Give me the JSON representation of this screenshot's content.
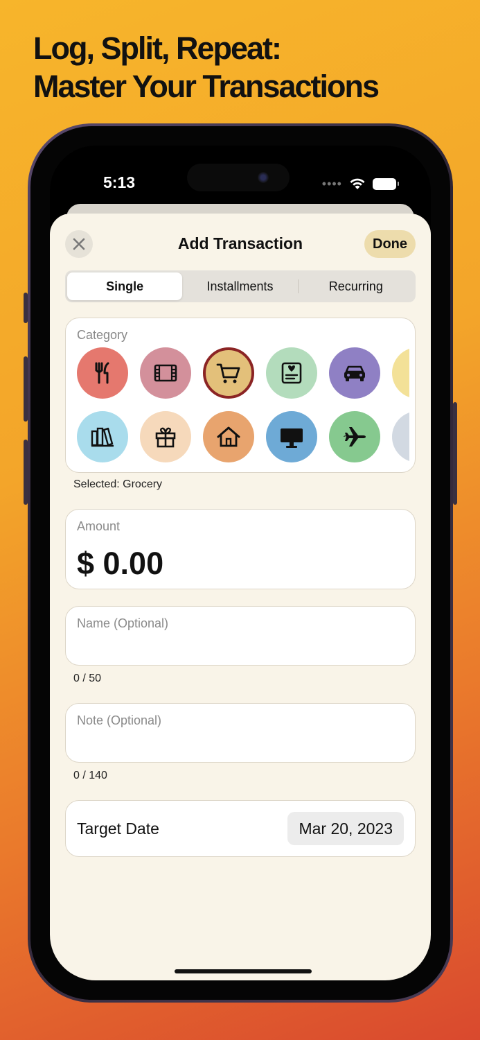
{
  "headline": {
    "line1": "Log, Split, Repeat:",
    "line2": "Master Your Transactions"
  },
  "status_bar": {
    "time": "5:13",
    "signal_dots": "••••"
  },
  "sheet": {
    "title": "Add Transaction",
    "close_icon": "x-mark-icon",
    "done_label": "Done"
  },
  "segments": [
    {
      "label": "Single",
      "selected": true
    },
    {
      "label": "Installments",
      "selected": false
    },
    {
      "label": "Recurring",
      "selected": false
    }
  ],
  "category": {
    "label": "Category",
    "selected_text": "Selected: Grocery",
    "icons": [
      {
        "name": "restaurant-icon",
        "color": "#e5786e"
      },
      {
        "name": "movie-film-icon",
        "color": "#d3909b"
      },
      {
        "name": "shopping-cart-icon",
        "color": "#e3c07a",
        "selected": true
      },
      {
        "name": "health-card-icon",
        "color": "#b3dcbc"
      },
      {
        "name": "car-icon",
        "color": "#8f80c4"
      },
      {
        "name": "partial-icon",
        "color": "#f3e198"
      },
      {
        "name": "books-icon",
        "color": "#a9dcec"
      },
      {
        "name": "gift-icon",
        "color": "#f6d9bb"
      },
      {
        "name": "home-icon",
        "color": "#e8a46e"
      },
      {
        "name": "computer-monitor-icon",
        "color": "#6eaad6"
      },
      {
        "name": "airplane-icon",
        "color": "#86c98f"
      },
      {
        "name": "dollar-icon",
        "color": "#d2d9e2"
      }
    ]
  },
  "amount": {
    "label": "Amount",
    "value": "$ 0.00"
  },
  "name_field": {
    "placeholder": "Name (Optional)",
    "counter": "0 / 50"
  },
  "note_field": {
    "placeholder": "Note (Optional)",
    "counter": "0 / 140"
  },
  "target_date": {
    "label": "Target Date",
    "value": "Mar 20, 2023"
  },
  "colors": {
    "sheet_background": "#f9f4e8",
    "done_button": "#eddcac",
    "selected_ring": "#8b2424"
  }
}
